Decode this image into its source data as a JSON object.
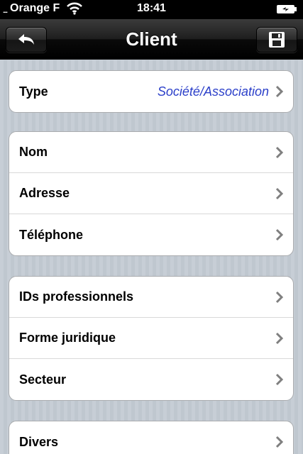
{
  "status_bar": {
    "signal": "....",
    "carrier": "Orange F",
    "time": "18:41",
    "wifi_icon": "wifi-icon",
    "battery_icon": "battery-charging-icon"
  },
  "nav": {
    "title": "Client",
    "back_icon": "back-arrow-icon",
    "save_icon": "save-disk-icon"
  },
  "groups": [
    {
      "rows": [
        {
          "label": "Type",
          "value": "Société/Association"
        }
      ]
    },
    {
      "rows": [
        {
          "label": "Nom"
        },
        {
          "label": "Adresse"
        },
        {
          "label": "Téléphone"
        }
      ]
    },
    {
      "rows": [
        {
          "label": "IDs professionnels"
        },
        {
          "label": "Forme juridique"
        },
        {
          "label": "Secteur"
        }
      ]
    },
    {
      "rows": [
        {
          "label": "Divers"
        }
      ]
    }
  ],
  "colors": {
    "value_text": "#2b3fc9",
    "nav_background": "#000000",
    "group_background": "#ffffff"
  }
}
